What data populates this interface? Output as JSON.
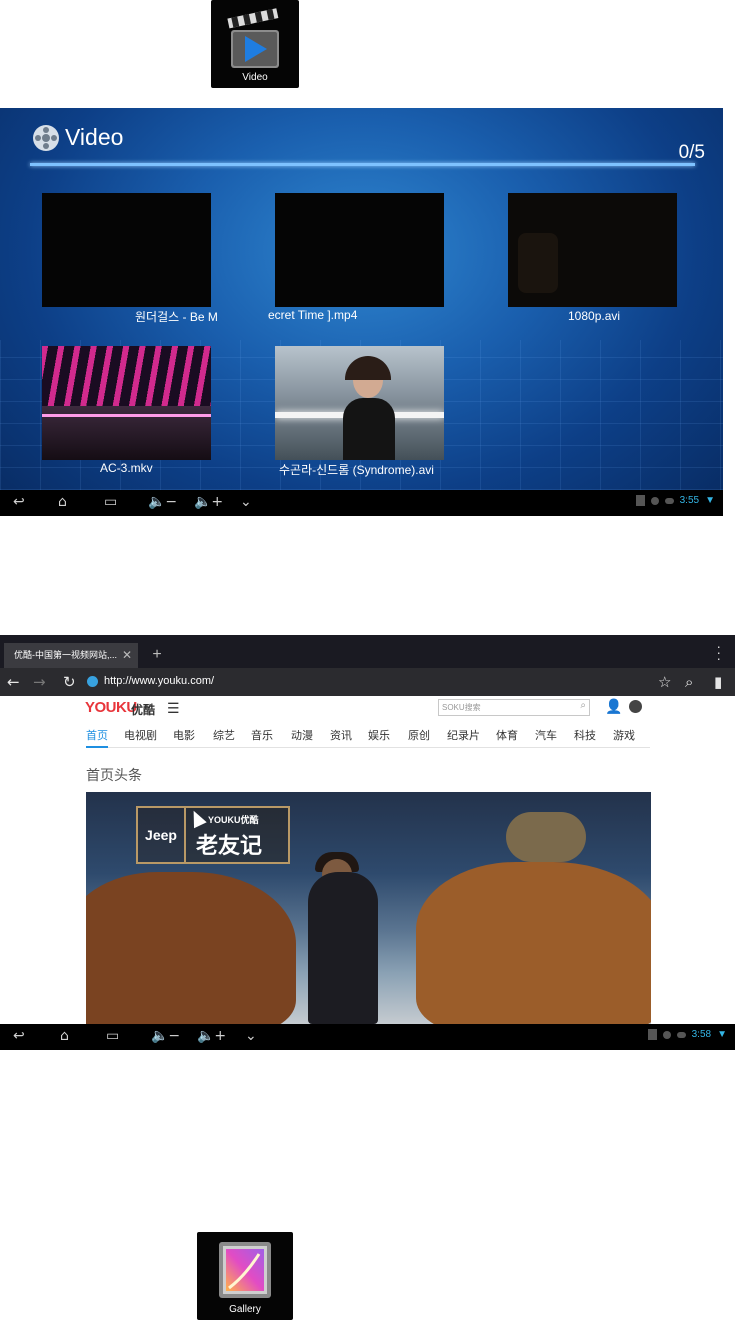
{
  "video_icon": {
    "label": "Video"
  },
  "gallery_icon": {
    "label": "Gallery"
  },
  "video_app": {
    "title": "Video",
    "count": "0/5",
    "files": [
      {
        "label": "원더걸스 - Be M",
        "thumb": "black"
      },
      {
        "label": "ecret Time ].mp4",
        "thumb": "black"
      },
      {
        "label": "1080p.avi",
        "thumb": "dark"
      },
      {
        "label": "AC-3.mkv",
        "thumb": "concert-stage"
      },
      {
        "label": "수곤라-신드롬 (Syndrome).avi",
        "thumb": "woman-portrait"
      }
    ],
    "status": {
      "time": "3:55"
    }
  },
  "browser": {
    "tab_title": "优酷-中国第一视频网站,...",
    "url": "http://www.youku.com/",
    "site": {
      "logo_latin": "YOUKU",
      "logo_cn": "优酷",
      "search_placeholder": "SOKU搜索",
      "nav": [
        "首页",
        "电视剧",
        "电影",
        "综艺",
        "音乐",
        "动漫",
        "资讯",
        "娱乐",
        "原创",
        "纪录片",
        "体育",
        "汽车",
        "科技",
        "游戏"
      ],
      "section_title": "首页头条",
      "banner": {
        "sponsor": "Jeep",
        "brand": "YOUKU优酷",
        "title": "老友记"
      }
    },
    "status": {
      "time": "3:58"
    }
  },
  "colors": {
    "status_accent": "#34b5e5",
    "youku_red": "#e8353b",
    "nav_active": "#1e8fe1"
  }
}
